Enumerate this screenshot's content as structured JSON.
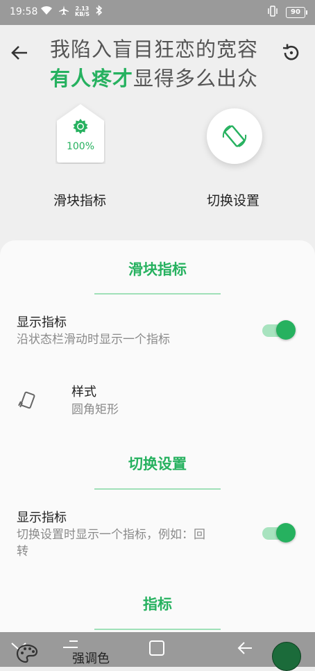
{
  "status_bar": {
    "time": "19:58",
    "net_speed_value": "2.13",
    "net_speed_unit": "KB/S",
    "battery": "90"
  },
  "header": {
    "lyric_line1": "我陷入盲目狂恋的宽容",
    "lyric_line2_highlight": "有人疼才",
    "lyric_line2_rest": "显得多么出众"
  },
  "preview": {
    "slider_percent": "100%",
    "slider_label": "滑块指标",
    "switch_label": "切换设置"
  },
  "sections": {
    "slider": {
      "title": "滑块指标",
      "show_indicator_title": "显示指标",
      "show_indicator_sub": "沿状态栏滑动时显示一个指标",
      "style_title": "样式",
      "style_value": "圆角矩形"
    },
    "switch": {
      "title": "切换设置",
      "show_indicator_title": "显示指标",
      "show_indicator_sub_line1": "切换设置时显示一个指标，例如：回",
      "show_indicator_sub_line2": "转"
    },
    "indicator": {
      "title": "指标"
    }
  },
  "bottom": {
    "accent_label": "强调色"
  },
  "colors": {
    "accent": "#26b15f",
    "accent_light": "#a8e3bf",
    "accent_swatch": "#1b6b3a"
  }
}
